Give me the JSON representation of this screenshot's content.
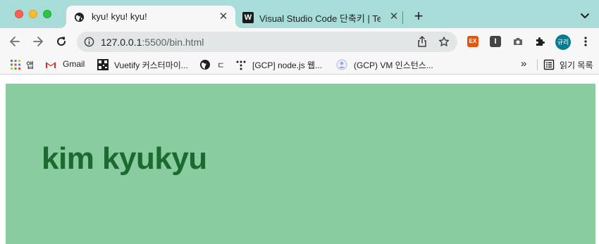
{
  "tabs": [
    {
      "title": "kyu! kyu! kyu!",
      "active": true,
      "favicon": "globe-icon"
    },
    {
      "title": "Visual Studio Code 단축키 | Tech",
      "active": false,
      "favicon": "W"
    }
  ],
  "toolbar": {
    "url_host": "127.0.0.1",
    "url_path": ":5500/bin.html",
    "extensions": {
      "ex_label": "EX",
      "i_label": "I"
    },
    "avatar_label": "규리"
  },
  "bookmarks": {
    "items": [
      {
        "label": "앱",
        "icon": "apps-grid-icon"
      },
      {
        "label": "Gmail",
        "icon": "gmail-icon"
      },
      {
        "label": "Vuetify 커스터마이...",
        "icon": "qr-icon"
      },
      {
        "label": "ㄷ",
        "icon": "globe-icon"
      },
      {
        "label": "[GCP] node.js 웹...",
        "icon": "dots-icon"
      },
      {
        "label": "(GCP) VM 인스턴스...",
        "icon": "person-icon"
      }
    ],
    "reading_list": "읽기 목록"
  },
  "page": {
    "heading": "kim kyukyu",
    "box_color": "#88cc9f",
    "heading_color": "#1b6a2f"
  },
  "colors": {
    "tabstrip": "#a7dcd9",
    "toolbar": "#f7f7f7"
  }
}
